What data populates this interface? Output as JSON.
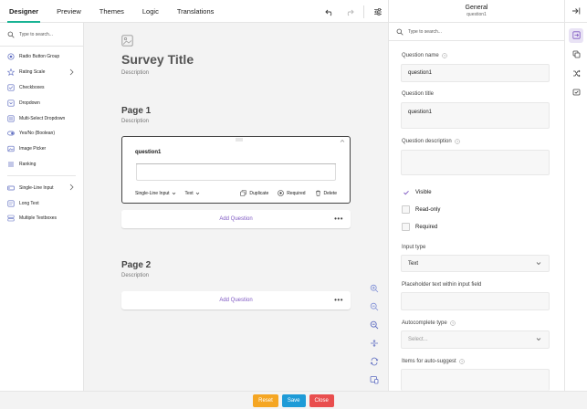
{
  "tabs": [
    {
      "label": "Designer",
      "active": true
    },
    {
      "label": "Preview"
    },
    {
      "label": "Themes"
    },
    {
      "label": "Logic"
    },
    {
      "label": "Translations"
    }
  ],
  "toolbox": {
    "search_placeholder": "Type to search...",
    "items": [
      {
        "label": "Radio Button Group",
        "icon": "radio-icon"
      },
      {
        "label": "Rating Scale",
        "icon": "star-icon",
        "has_submenu": true
      },
      {
        "label": "Checkboxes",
        "icon": "checkbox-icon"
      },
      {
        "label": "Dropdown",
        "icon": "dropdown-icon"
      },
      {
        "label": "Multi-Select Dropdown",
        "icon": "multiselect-icon"
      },
      {
        "label": "Yes/No (Boolean)",
        "icon": "toggle-icon"
      },
      {
        "label": "Image Picker",
        "icon": "image-icon"
      },
      {
        "label": "Ranking",
        "icon": "ranking-icon"
      },
      {
        "label": "Single-Line Input",
        "icon": "input-icon",
        "has_submenu": true
      },
      {
        "label": "Long Text",
        "icon": "text-icon"
      },
      {
        "label": "Multiple Textboxes",
        "icon": "textboxes-icon"
      }
    ]
  },
  "survey": {
    "title": "Survey Title",
    "description": "Description",
    "pages": [
      {
        "title": "Page 1",
        "description": "Description"
      },
      {
        "title": "Page 2",
        "description": "Description"
      }
    ],
    "question": {
      "title": "question1",
      "type_label": "Single-Line Input",
      "input_type_label": "Text",
      "duplicate_label": "Duplicate",
      "required_label": "Required",
      "delete_label": "Delete"
    },
    "add_question_label": "Add Question"
  },
  "panel": {
    "header_title": "General",
    "header_subtitle": "question1",
    "search_placeholder": "Type to search...",
    "question_name_label": "Question name",
    "question_name_value": "question1",
    "question_title_label": "Question title",
    "question_title_value": "question1",
    "question_description_label": "Question description",
    "visible_label": "Visible",
    "readonly_label": "Read-only",
    "required_label": "Required",
    "input_type_label": "Input type",
    "input_type_value": "Text",
    "placeholder_label": "Placeholder text within input field",
    "autocomplete_label": "Autocomplete type",
    "autocomplete_placeholder": "Select...",
    "autosuggest_label": "Items for auto-suggest"
  },
  "bottom": {
    "reset_label": "Reset",
    "save_label": "Save",
    "close_label": "Close"
  },
  "colors": {
    "accent": "#19b394",
    "brand_purple": "#7e57c2",
    "reset": "#f5a623",
    "save": "#1e9bd7",
    "close": "#e94e4e"
  }
}
